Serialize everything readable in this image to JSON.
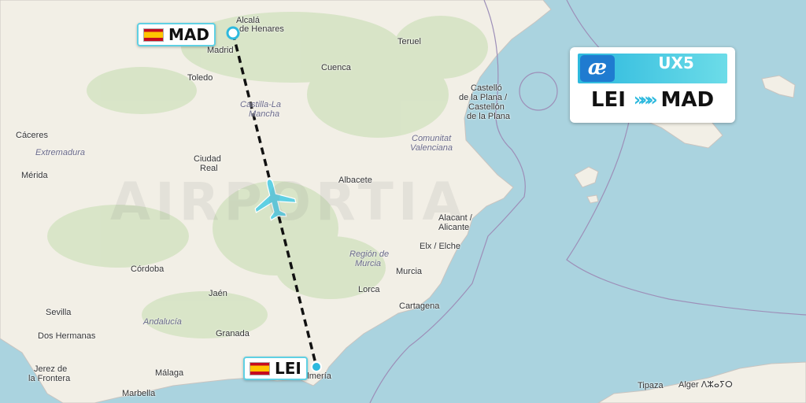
{
  "flight": {
    "number": "UX5",
    "airline_logo": "æ",
    "origin": "LEI",
    "destination": "MAD",
    "arrow": "»»»"
  },
  "airports": {
    "madrid": {
      "code": "MAD",
      "flag": "spain-flag"
    },
    "almeria": {
      "code": "LEI",
      "flag": "spain-flag"
    }
  },
  "watermark": "AIRPORTIA",
  "cities": {
    "alcala": "Alcalá",
    "henares": "de Henares",
    "madrid": "Madrid",
    "teruel": "Teruel",
    "cuenca": "Cuenca",
    "toledo": "Toledo",
    "castello1": "Castelló",
    "castello2": "de la Plana /",
    "castello3": "Castellón",
    "castello4": "de la Plana",
    "caceres": "Cáceres",
    "ciudadreal1": "Ciudad",
    "ciudadreal2": "Real",
    "merida": "Mérida",
    "albacete": "Albacete",
    "alicant1": "Alacant /",
    "alicant2": "Alicante",
    "elx": "Elx / Elche",
    "cordoba": "Córdoba",
    "murcia": "Murcia",
    "jaen": "Jaén",
    "lorca": "Lorca",
    "cartagena": "Cartagena",
    "sevilla": "Sevilla",
    "doshermanas": "Dos Hermanas",
    "granada": "Granada",
    "jerez1": "Jerez de",
    "jerez2": "la Frontera",
    "malaga": "Málaga",
    "almeria": "Almería",
    "marbella": "Marbella",
    "tipaza": "Tipaza",
    "alger": "Alger ⴷⵣⴰⵢⵔ"
  },
  "regions": {
    "castilla1": "Castilla-La",
    "castilla2": "Mancha",
    "extremadura": "Extremadura",
    "valenciana1": "Comunitat",
    "valenciana2": "Valenciana",
    "murcia1": "Región de",
    "murcia2": "Murcia",
    "andalucia": "Andalucía"
  },
  "colors": {
    "land": "#f2efe6",
    "sea": "#aad3df",
    "route": "#111111",
    "accent": "#2db9de",
    "airline_blue": "#1f7bd0"
  },
  "icons": [
    "plane-icon",
    "spain-flag",
    "airport-marker"
  ]
}
